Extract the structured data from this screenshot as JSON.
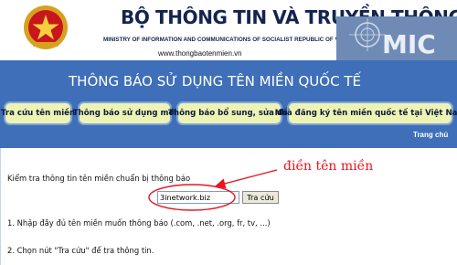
{
  "header": {
    "title": "BỘ THÔNG TIN VÀ TRUYỀN THÔNG",
    "subtitle": "MINISTRY OF INFORMATION AND COMMUNICATIONS OF SOCIALIST REPUBLIC OF VIET NAM",
    "url": "www.thongbaotenmien.vn",
    "logo_text": "MIC",
    "emblem_icon": "national-emblem-icon"
  },
  "banner": {
    "title": "THÔNG BÁO SỬ DỤNG TÊN MIỀN QUỐC TẾ",
    "nav": [
      {
        "label": "Tra cứu tên miền"
      },
      {
        "label": "Thông báo sử dụng mới"
      },
      {
        "label": "Thông báo bổ sung, sửa đổi"
      },
      {
        "label": "Nhà đăng ký tên miền quốc tế tại Việt Nam"
      }
    ],
    "home_label": "Trang chủ"
  },
  "content": {
    "intro": "Kiểm tra thông tin tên miền chuẩn bị thông báo",
    "search_value": "3inetwork.biz",
    "search_button": "Tra cứu",
    "step1": "1. Nhập đầy đủ tên miền muốn thông báo (.com, .net, .org, fr, tv, ...)",
    "step2": "2. Chọn nút \"Tra cứu\" để tra thông tin."
  },
  "annotation": {
    "text": "điền tên miền",
    "color": "#e8141e"
  },
  "colors": {
    "banner": "#3f6fb9",
    "title": "#13244f",
    "nav_bg": "#eef3b3",
    "nav_border": "#7da5d9"
  }
}
